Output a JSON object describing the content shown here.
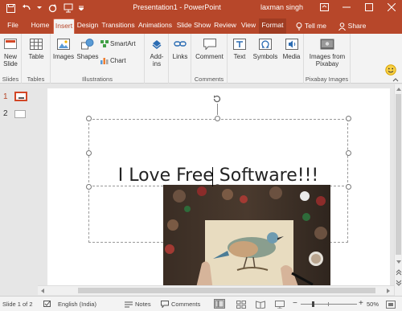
{
  "window": {
    "title": "Presentation1  -  PowerPoint",
    "user": "laxman singh"
  },
  "tabs": [
    {
      "label": "File"
    },
    {
      "label": "Home"
    },
    {
      "label": "Insert"
    },
    {
      "label": "Design"
    },
    {
      "label": "Transitions"
    },
    {
      "label": "Animations"
    },
    {
      "label": "Slide Show"
    },
    {
      "label": "Review"
    },
    {
      "label": "View"
    },
    {
      "label": "Format"
    },
    {
      "label": "Tell me"
    },
    {
      "label": "Share"
    }
  ],
  "ribbon": {
    "groups": {
      "slides": "Slides",
      "tables": "Tables",
      "illustrations": "Illustrations",
      "comments": "Comments",
      "pixabay": "Pixabay Images"
    },
    "buttons": {
      "new_slide": "New Slide",
      "table": "Table",
      "images": "Images",
      "shapes": "Shapes",
      "smartart": "SmartArt",
      "chart": "Chart",
      "addins": "Add-ins",
      "links": "Links",
      "comment": "Comment",
      "text": "Text",
      "symbols": "Symbols",
      "media": "Media",
      "images_from_pixabay": "Images from Pixabay"
    }
  },
  "thumbnails": [
    {
      "number": "1"
    },
    {
      "number": "2"
    }
  ],
  "slide": {
    "title_text": "I Love Free Software!!!"
  },
  "status": {
    "slide_counter": "Slide 1 of 2",
    "language": "English (India)",
    "notes": "Notes",
    "comments": "Comments",
    "zoom": "50%"
  },
  "colors": {
    "accent": "#b7472a",
    "ribbon_bg": "#f3f3f3",
    "workspace_bg": "#e6e6e6"
  }
}
